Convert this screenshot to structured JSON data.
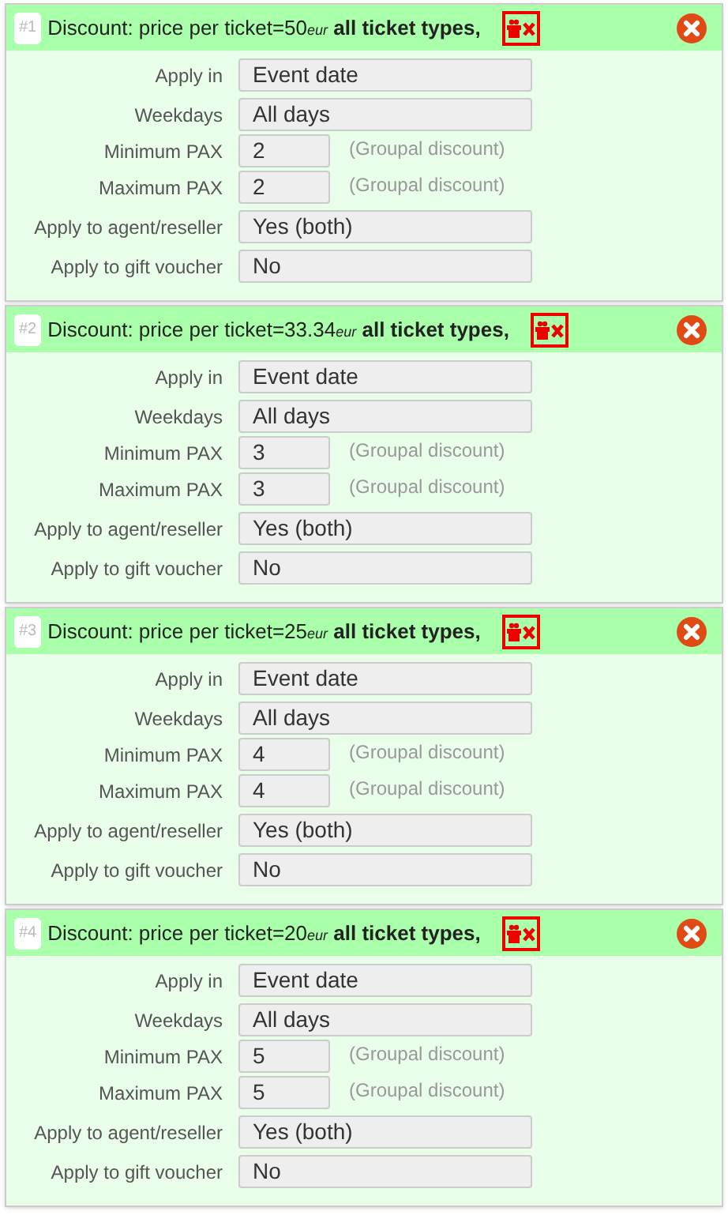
{
  "discounts": [
    {
      "number": "#1",
      "title": "Discount: price per ticket=50$_{eur}$ **all ticket types,**",
      "fields": [
        {
          "label": "Apply in",
          "kind": "select",
          "value": "Event date"
        },
        {
          "label": "Weekdays",
          "kind": "select",
          "value": "All days"
        },
        {
          "label": "Minimum PAX",
          "kind": "number",
          "value": "2",
          "note": "(Groupal discount)"
        },
        {
          "label": "Maximum PAX",
          "kind": "number",
          "value": "2",
          "note": "(Groupal discount)"
        },
        {
          "label": "Apply to agent/reseller",
          "kind": "select",
          "value": "Yes (both)"
        },
        {
          "label": "Apply to gift voucher",
          "kind": "select",
          "value": "No"
        }
      ]
    },
    {
      "number": "#2",
      "title": "Discount: price per ticket=33.34$_{eur}$ **all ticket types,**",
      "fields": [
        {
          "label": "Apply in",
          "kind": "select",
          "value": "Event date"
        },
        {
          "label": "Weekdays",
          "kind": "select",
          "value": "All days"
        },
        {
          "label": "Minimum PAX",
          "kind": "number",
          "value": "3",
          "note": "(Groupal discount)"
        },
        {
          "label": "Maximum PAX",
          "kind": "number",
          "value": "3",
          "note": "(Groupal discount)"
        },
        {
          "label": "Apply to agent/reseller",
          "kind": "select",
          "value": "Yes (both)"
        },
        {
          "label": "Apply to gift voucher",
          "kind": "select",
          "value": "No"
        }
      ]
    },
    {
      "number": "#3",
      "title": "Discount: price per ticket=25$_{eur}$ **all ticket types,**",
      "fields": [
        {
          "label": "Apply in",
          "kind": "select",
          "value": "Event date"
        },
        {
          "label": "Weekdays",
          "kind": "select",
          "value": "All days"
        },
        {
          "label": "Minimum PAX",
          "kind": "number",
          "value": "4",
          "note": "(Groupal discount)"
        },
        {
          "label": "Maximum PAX",
          "kind": "number",
          "value": "4",
          "note": "(Groupal discount)"
        },
        {
          "label": "Apply to agent/reseller",
          "kind": "select",
          "value": "Yes (both)"
        },
        {
          "label": "Apply to gift voucher",
          "kind": "select",
          "value": "No"
        }
      ]
    },
    {
      "number": "#4",
      "title": "Discount: price per ticket=20$_{eur}$ **all ticket types,**",
      "fields": [
        {
          "label": "Apply in",
          "kind": "select",
          "value": "Event date"
        },
        {
          "label": "Weekdays",
          "kind": "select",
          "value": "All days"
        },
        {
          "label": "Minimum PAX",
          "kind": "number",
          "value": "5",
          "note": "(Groupal discount)"
        },
        {
          "label": "Maximum PAX",
          "kind": "number",
          "value": "5",
          "note": "(Groupal discount)"
        },
        {
          "label": "Apply to agent/reseller",
          "kind": "select",
          "value": "Yes (both)"
        },
        {
          "label": "Apply to gift voucher",
          "kind": "select",
          "value": "No"
        }
      ]
    }
  ]
}
